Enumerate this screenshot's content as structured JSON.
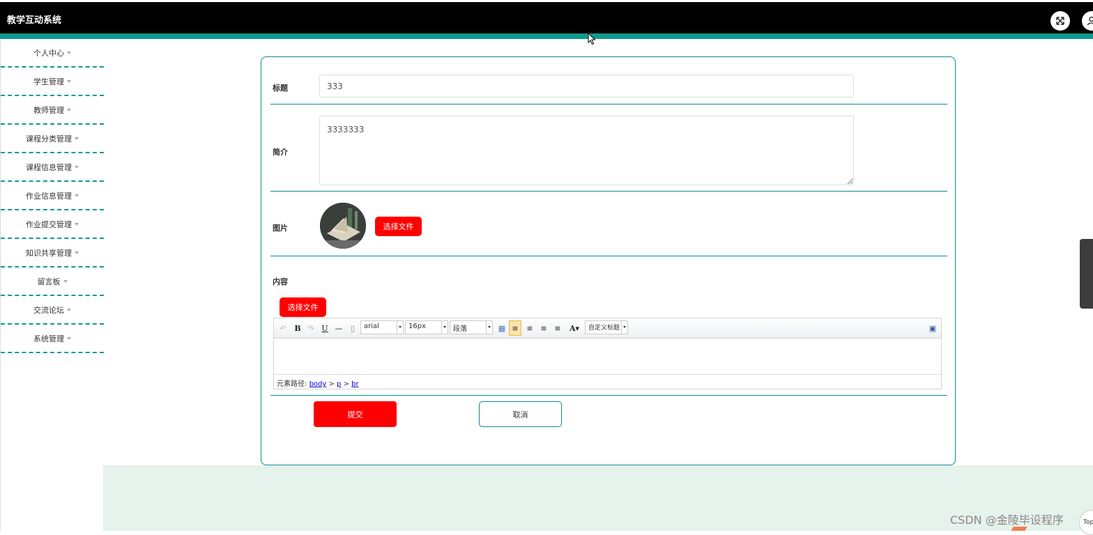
{
  "app": {
    "title": "教学互动系统"
  },
  "sidebar": {
    "items": [
      {
        "label": "个人中心"
      },
      {
        "label": "学生管理"
      },
      {
        "label": "教师管理"
      },
      {
        "label": "课程分类管理"
      },
      {
        "label": "课程信息管理"
      },
      {
        "label": "作业信息管理"
      },
      {
        "label": "作业提交管理"
      },
      {
        "label": "知识共享管理"
      },
      {
        "label": "留言板"
      },
      {
        "label": "交流论坛"
      },
      {
        "label": "系统管理"
      }
    ]
  },
  "form": {
    "title_label": "标题",
    "title_value": "333",
    "intro_label": "简介",
    "intro_value": "3333333",
    "image_label": "图片",
    "image_choose": "选择文件",
    "content_label": "内容",
    "content_choose": "选择文件",
    "submit": "提交",
    "cancel": "取消"
  },
  "editor": {
    "font": "arial",
    "size": "16px",
    "para": "段落",
    "custom_title": "自定义标题",
    "path_label": "元素路径:",
    "path": [
      "body",
      "p",
      "br"
    ]
  },
  "footer": {
    "watermark": "CSDN @金陵毕设程序",
    "top": "Top"
  },
  "colors": {
    "header_bg": "#000000",
    "accent_teal": "#0f9a8c",
    "primary_red": "#ff0000",
    "footer_band": "#e6f2ec"
  },
  "icons": [
    "fullscreen-icon",
    "user-icon",
    "mouse-cursor-icon"
  ]
}
